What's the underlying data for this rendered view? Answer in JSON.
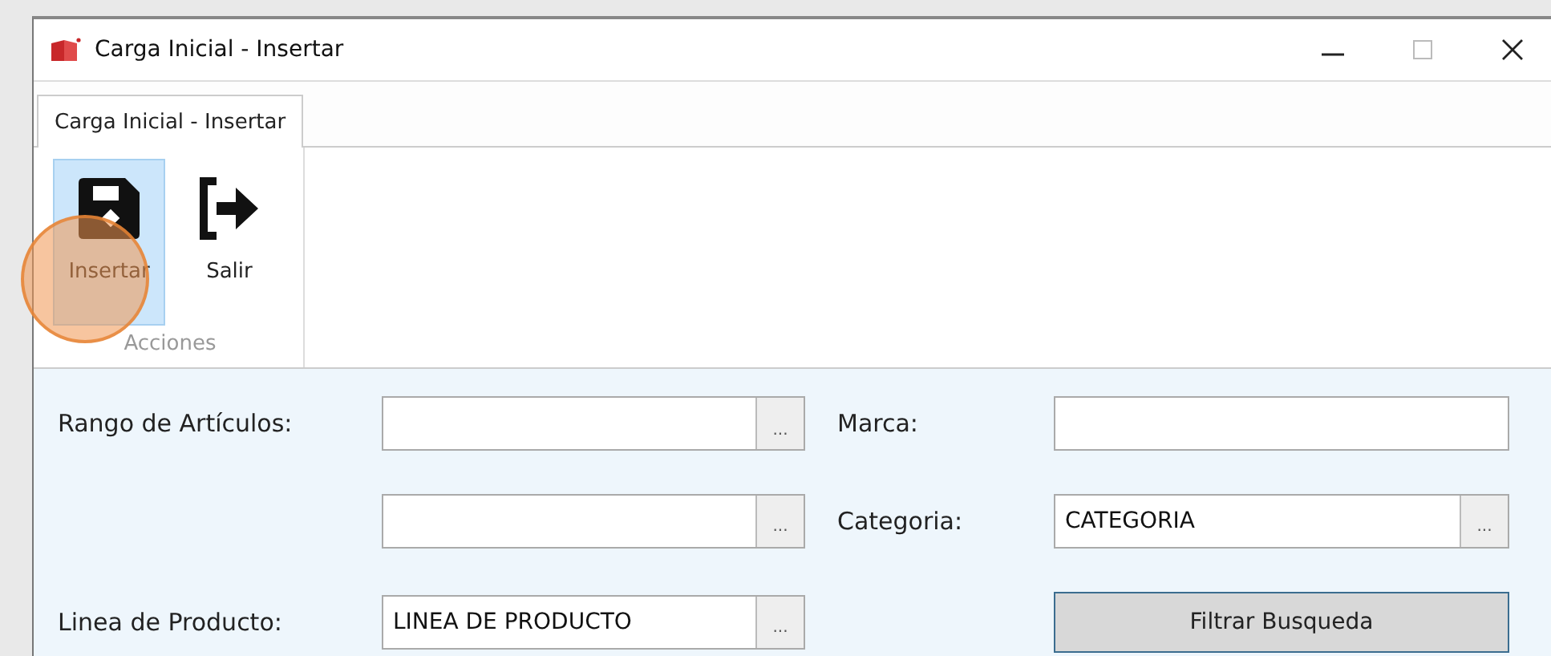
{
  "window": {
    "title": "Carga Inicial - Insertar"
  },
  "tabs": [
    {
      "label": "Carga Inicial - Insertar",
      "selected": true
    }
  ],
  "ribbon": {
    "buttons": [
      {
        "label": "Insertar",
        "kind": "save",
        "selected": true
      },
      {
        "label": "Salir",
        "kind": "exit",
        "selected": false
      }
    ],
    "group_label": "Acciones"
  },
  "click_highlight": true,
  "form": {
    "rows": [
      {
        "left": {
          "label": "Rango de Artículos:",
          "kind": "lookup",
          "browse": "..."
        },
        "right": {
          "label": "Marca:",
          "kind": "text"
        }
      },
      {
        "left": {
          "kind": "lookup",
          "browse": "..."
        },
        "right": {
          "label": "Categoria:",
          "kind": "lookup",
          "value": "CATEGORIA",
          "browse": "..."
        }
      },
      {
        "left": {
          "label": "Linea de Producto:",
          "kind": "lookup",
          "value": "LINEA DE PRODUCTO",
          "browse": "..."
        },
        "right": {
          "kind": "button",
          "label": "Filtrar Busqueda"
        }
      }
    ]
  }
}
